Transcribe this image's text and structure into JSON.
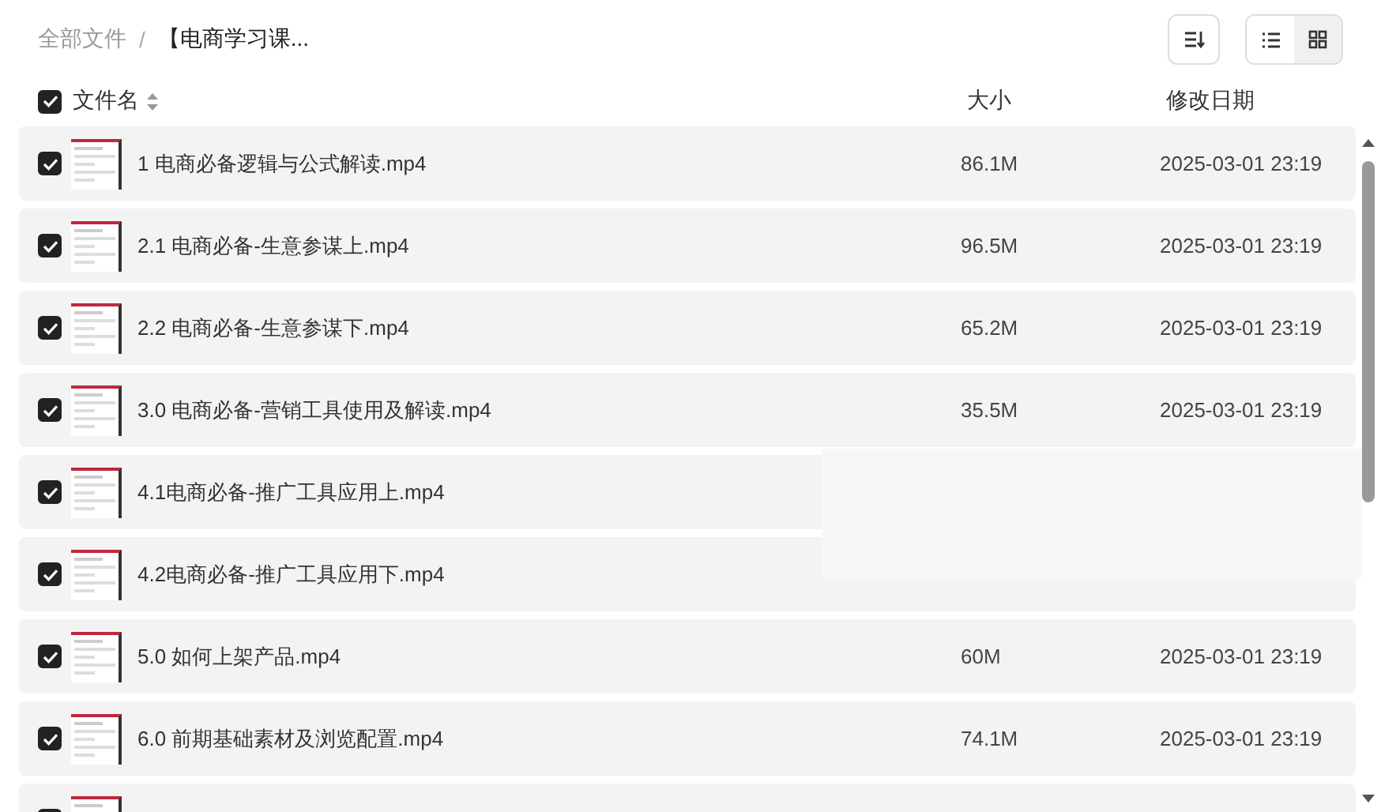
{
  "breadcrumb": [
    {
      "label": "全部文件"
    },
    {
      "label": "【电商学习课..."
    }
  ],
  "breadcrumb_separator": "/",
  "view_modes": [
    {
      "kind": "list",
      "selected": false
    },
    {
      "kind": "grid",
      "selected": true
    }
  ],
  "header": {
    "checked": true,
    "name": "文件名",
    "size": "大小",
    "date": "修改日期"
  },
  "rows": [
    {
      "checked": true,
      "name": "1 电商必备逻辑与公式解读.mp4",
      "size": "86.1M",
      "date": "2025-03-01 23:19"
    },
    {
      "checked": true,
      "name": "2.1 电商必备-生意参谋上.mp4",
      "size": "96.5M",
      "date": "2025-03-01 23:19"
    },
    {
      "checked": true,
      "name": "2.2 电商必备-生意参谋下.mp4",
      "size": "65.2M",
      "date": "2025-03-01 23:19"
    },
    {
      "checked": true,
      "name": "3.0 电商必备-营销工具使用及解读.mp4",
      "size": "35.5M",
      "date": "2025-03-01 23:19"
    },
    {
      "checked": true,
      "name": "4.1电商必备-推广工具应用上.mp4"
    },
    {
      "checked": true,
      "name": "4.2电商必备-推广工具应用下.mp4"
    },
    {
      "checked": true,
      "name": "5.0 如何上架产品.mp4",
      "size": "60M",
      "date": "2025-03-01 23:19"
    },
    {
      "checked": true,
      "name": "6.0 前期基础素材及浏览配置.mp4",
      "size": "74.1M",
      "date": "2025-03-01 23:19"
    },
    {
      "checked": true
    }
  ]
}
